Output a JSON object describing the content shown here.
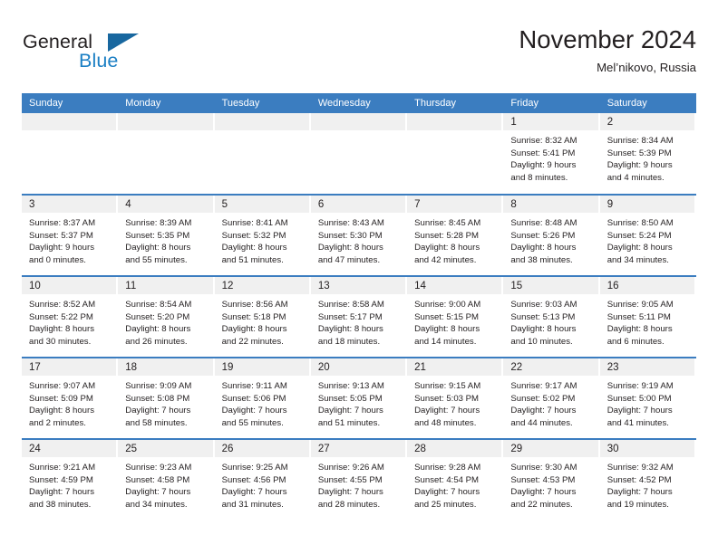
{
  "brand": {
    "word_one": "General",
    "word_two": "Blue",
    "flag_icon": "triangle-flag-icon"
  },
  "header": {
    "title": "November 2024",
    "location": "Mel’nikovo, Russia"
  },
  "colors": {
    "header_blue": "#3b7dc0",
    "brand_blue": "#1b7fc4",
    "brand_dark_blue": "#18679f",
    "date_band_gray": "#f0f0f0",
    "text": "#231f20"
  },
  "calendar": {
    "weekday_headers": [
      "Sunday",
      "Monday",
      "Tuesday",
      "Wednesday",
      "Thursday",
      "Friday",
      "Saturday"
    ],
    "weeks": [
      [
        {
          "day": "",
          "lines": []
        },
        {
          "day": "",
          "lines": []
        },
        {
          "day": "",
          "lines": []
        },
        {
          "day": "",
          "lines": []
        },
        {
          "day": "",
          "lines": []
        },
        {
          "day": "1",
          "lines": [
            "Sunrise: 8:32 AM",
            "Sunset: 5:41 PM",
            "Daylight: 9 hours",
            "and 8 minutes."
          ]
        },
        {
          "day": "2",
          "lines": [
            "Sunrise: 8:34 AM",
            "Sunset: 5:39 PM",
            "Daylight: 9 hours",
            "and 4 minutes."
          ]
        }
      ],
      [
        {
          "day": "3",
          "lines": [
            "Sunrise: 8:37 AM",
            "Sunset: 5:37 PM",
            "Daylight: 9 hours",
            "and 0 minutes."
          ]
        },
        {
          "day": "4",
          "lines": [
            "Sunrise: 8:39 AM",
            "Sunset: 5:35 PM",
            "Daylight: 8 hours",
            "and 55 minutes."
          ]
        },
        {
          "day": "5",
          "lines": [
            "Sunrise: 8:41 AM",
            "Sunset: 5:32 PM",
            "Daylight: 8 hours",
            "and 51 minutes."
          ]
        },
        {
          "day": "6",
          "lines": [
            "Sunrise: 8:43 AM",
            "Sunset: 5:30 PM",
            "Daylight: 8 hours",
            "and 47 minutes."
          ]
        },
        {
          "day": "7",
          "lines": [
            "Sunrise: 8:45 AM",
            "Sunset: 5:28 PM",
            "Daylight: 8 hours",
            "and 42 minutes."
          ]
        },
        {
          "day": "8",
          "lines": [
            "Sunrise: 8:48 AM",
            "Sunset: 5:26 PM",
            "Daylight: 8 hours",
            "and 38 minutes."
          ]
        },
        {
          "day": "9",
          "lines": [
            "Sunrise: 8:50 AM",
            "Sunset: 5:24 PM",
            "Daylight: 8 hours",
            "and 34 minutes."
          ]
        }
      ],
      [
        {
          "day": "10",
          "lines": [
            "Sunrise: 8:52 AM",
            "Sunset: 5:22 PM",
            "Daylight: 8 hours",
            "and 30 minutes."
          ]
        },
        {
          "day": "11",
          "lines": [
            "Sunrise: 8:54 AM",
            "Sunset: 5:20 PM",
            "Daylight: 8 hours",
            "and 26 minutes."
          ]
        },
        {
          "day": "12",
          "lines": [
            "Sunrise: 8:56 AM",
            "Sunset: 5:18 PM",
            "Daylight: 8 hours",
            "and 22 minutes."
          ]
        },
        {
          "day": "13",
          "lines": [
            "Sunrise: 8:58 AM",
            "Sunset: 5:17 PM",
            "Daylight: 8 hours",
            "and 18 minutes."
          ]
        },
        {
          "day": "14",
          "lines": [
            "Sunrise: 9:00 AM",
            "Sunset: 5:15 PM",
            "Daylight: 8 hours",
            "and 14 minutes."
          ]
        },
        {
          "day": "15",
          "lines": [
            "Sunrise: 9:03 AM",
            "Sunset: 5:13 PM",
            "Daylight: 8 hours",
            "and 10 minutes."
          ]
        },
        {
          "day": "16",
          "lines": [
            "Sunrise: 9:05 AM",
            "Sunset: 5:11 PM",
            "Daylight: 8 hours",
            "and 6 minutes."
          ]
        }
      ],
      [
        {
          "day": "17",
          "lines": [
            "Sunrise: 9:07 AM",
            "Sunset: 5:09 PM",
            "Daylight: 8 hours",
            "and 2 minutes."
          ]
        },
        {
          "day": "18",
          "lines": [
            "Sunrise: 9:09 AM",
            "Sunset: 5:08 PM",
            "Daylight: 7 hours",
            "and 58 minutes."
          ]
        },
        {
          "day": "19",
          "lines": [
            "Sunrise: 9:11 AM",
            "Sunset: 5:06 PM",
            "Daylight: 7 hours",
            "and 55 minutes."
          ]
        },
        {
          "day": "20",
          "lines": [
            "Sunrise: 9:13 AM",
            "Sunset: 5:05 PM",
            "Daylight: 7 hours",
            "and 51 minutes."
          ]
        },
        {
          "day": "21",
          "lines": [
            "Sunrise: 9:15 AM",
            "Sunset: 5:03 PM",
            "Daylight: 7 hours",
            "and 48 minutes."
          ]
        },
        {
          "day": "22",
          "lines": [
            "Sunrise: 9:17 AM",
            "Sunset: 5:02 PM",
            "Daylight: 7 hours",
            "and 44 minutes."
          ]
        },
        {
          "day": "23",
          "lines": [
            "Sunrise: 9:19 AM",
            "Sunset: 5:00 PM",
            "Daylight: 7 hours",
            "and 41 minutes."
          ]
        }
      ],
      [
        {
          "day": "24",
          "lines": [
            "Sunrise: 9:21 AM",
            "Sunset: 4:59 PM",
            "Daylight: 7 hours",
            "and 38 minutes."
          ]
        },
        {
          "day": "25",
          "lines": [
            "Sunrise: 9:23 AM",
            "Sunset: 4:58 PM",
            "Daylight: 7 hours",
            "and 34 minutes."
          ]
        },
        {
          "day": "26",
          "lines": [
            "Sunrise: 9:25 AM",
            "Sunset: 4:56 PM",
            "Daylight: 7 hours",
            "and 31 minutes."
          ]
        },
        {
          "day": "27",
          "lines": [
            "Sunrise: 9:26 AM",
            "Sunset: 4:55 PM",
            "Daylight: 7 hours",
            "and 28 minutes."
          ]
        },
        {
          "day": "28",
          "lines": [
            "Sunrise: 9:28 AM",
            "Sunset: 4:54 PM",
            "Daylight: 7 hours",
            "and 25 minutes."
          ]
        },
        {
          "day": "29",
          "lines": [
            "Sunrise: 9:30 AM",
            "Sunset: 4:53 PM",
            "Daylight: 7 hours",
            "and 22 minutes."
          ]
        },
        {
          "day": "30",
          "lines": [
            "Sunrise: 9:32 AM",
            "Sunset: 4:52 PM",
            "Daylight: 7 hours",
            "and 19 minutes."
          ]
        }
      ]
    ]
  }
}
